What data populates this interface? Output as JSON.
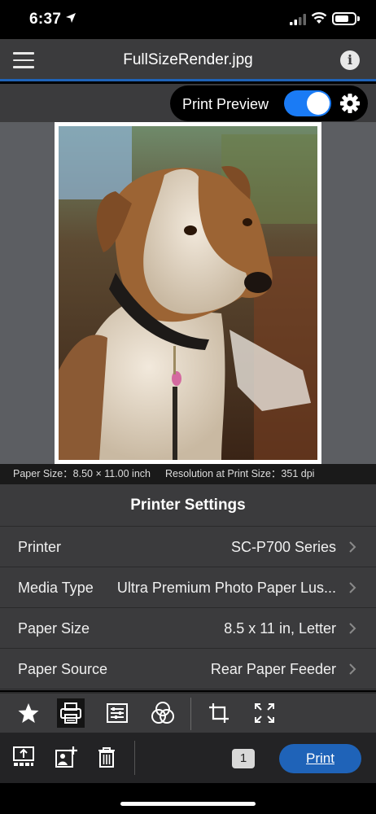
{
  "status_bar": {
    "time": "6:37"
  },
  "header": {
    "title": "FullSizeRender.jpg"
  },
  "preview": {
    "label": "Print Preview",
    "enabled": true
  },
  "info_line": {
    "paper_size": "Paper Size：8.50 × 11.00 inch",
    "resolution": "Resolution at Print Size：351 dpi"
  },
  "settings": {
    "title": "Printer Settings",
    "rows": [
      {
        "label": "Printer",
        "value": "SC-P700 Series"
      },
      {
        "label": "Media Type",
        "value": "Ultra Premium Photo Paper Lus..."
      },
      {
        "label": "Paper Size",
        "value": "8.5 x 11 in, Letter"
      },
      {
        "label": "Paper Source",
        "value": "Rear Paper Feeder"
      }
    ]
  },
  "toolbar": {
    "icons": [
      "star-icon",
      "printer-icon",
      "settings-list-icon",
      "color-adjust-icon",
      "crop-icon",
      "fit-expand-icon"
    ],
    "selected": "printer-icon"
  },
  "actions": {
    "copies": "1",
    "print_label": "Print",
    "icons": [
      "upload-icon",
      "add-photo-icon",
      "trash-icon"
    ]
  },
  "colors": {
    "accent": "#1f63b8",
    "toggle": "#1a7bf5",
    "panel": "#3b3b3d"
  }
}
